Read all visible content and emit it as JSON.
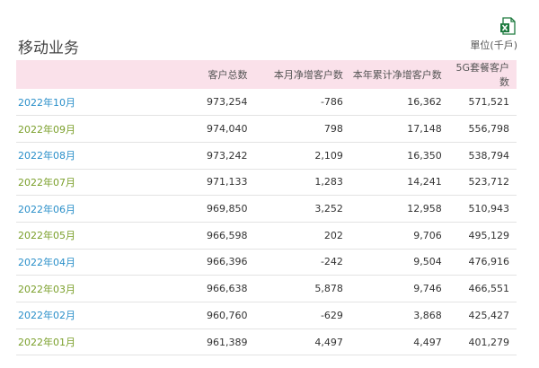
{
  "title": "移动业务",
  "unit": "單位(千戶)",
  "icons": {
    "export": "excel-icon"
  },
  "colors": {
    "header_bg": "#fae1ea",
    "month_blue": "#2a8fc9",
    "month_green": "#7a9f2a"
  },
  "table": {
    "headers": [
      "",
      "客户总数",
      "本月净增客户数",
      "本年累计净增客户数",
      "5G套餐客户数"
    ],
    "rows": [
      {
        "month": "2022年10月",
        "total": "973,254",
        "net_add": "-786",
        "ytd_net_add": "16,362",
        "fiveg": "571,521"
      },
      {
        "month": "2022年09月",
        "total": "974,040",
        "net_add": "798",
        "ytd_net_add": "17,148",
        "fiveg": "556,798"
      },
      {
        "month": "2022年08月",
        "total": "973,242",
        "net_add": "2,109",
        "ytd_net_add": "16,350",
        "fiveg": "538,794"
      },
      {
        "month": "2022年07月",
        "total": "971,133",
        "net_add": "1,283",
        "ytd_net_add": "14,241",
        "fiveg": "523,712"
      },
      {
        "month": "2022年06月",
        "total": "969,850",
        "net_add": "3,252",
        "ytd_net_add": "12,958",
        "fiveg": "510,943"
      },
      {
        "month": "2022年05月",
        "total": "966,598",
        "net_add": "202",
        "ytd_net_add": "9,706",
        "fiveg": "495,129"
      },
      {
        "month": "2022年04月",
        "total": "966,396",
        "net_add": "-242",
        "ytd_net_add": "9,504",
        "fiveg": "476,916"
      },
      {
        "month": "2022年03月",
        "total": "966,638",
        "net_add": "5,878",
        "ytd_net_add": "9,746",
        "fiveg": "466,551"
      },
      {
        "month": "2022年02月",
        "total": "960,760",
        "net_add": "-629",
        "ytd_net_add": "3,868",
        "fiveg": "425,427"
      },
      {
        "month": "2022年01月",
        "total": "961,389",
        "net_add": "4,497",
        "ytd_net_add": "4,497",
        "fiveg": "401,279"
      }
    ]
  }
}
